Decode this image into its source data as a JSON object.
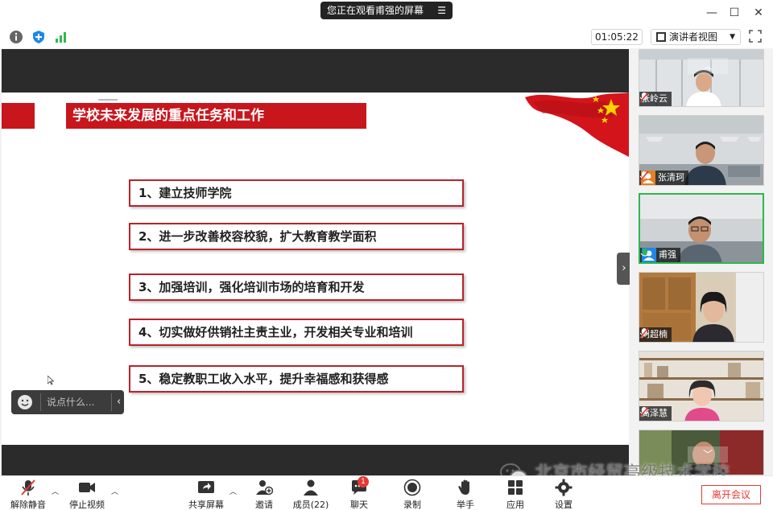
{
  "titlebar": {
    "share_status": "您正在观看甫强的屏幕"
  },
  "infobar": {
    "timer": "01:05:22",
    "view_label": "演讲者视图"
  },
  "slide": {
    "title": "学校未来发展的重点任务和工作",
    "items": [
      "1、建立技师学院",
      "2、进一步改善校容校貌，扩大教育教学面积",
      "3、加强培训，强化培训市场的培育和开发",
      "4、切实做好供销社主责主业，开发相关专业和培训",
      "5、稳定教职工收入水平，提升幸福感和获得感"
    ]
  },
  "chat": {
    "placeholder": "说点什么..."
  },
  "participants": [
    {
      "name": "张岭云"
    },
    {
      "name": "张清珂"
    },
    {
      "name": "甫强"
    },
    {
      "name": "刘超楠"
    },
    {
      "name": "高泽慧"
    }
  ],
  "toolbar": {
    "unmute": "解除静音",
    "stop_video": "停止视频",
    "share_screen": "共享屏幕",
    "invite": "邀请",
    "members": "成员(22)",
    "chat": "聊天",
    "chat_badge": "1",
    "record": "录制",
    "raise_hand": "举手",
    "apps": "应用",
    "settings": "设置",
    "leave": "离开会议"
  },
  "watermark": "北京市经贸高级技术学校",
  "colors": {
    "slide_red": "#c8161d",
    "active_green": "#2db84d",
    "leave_red": "#e53935"
  }
}
